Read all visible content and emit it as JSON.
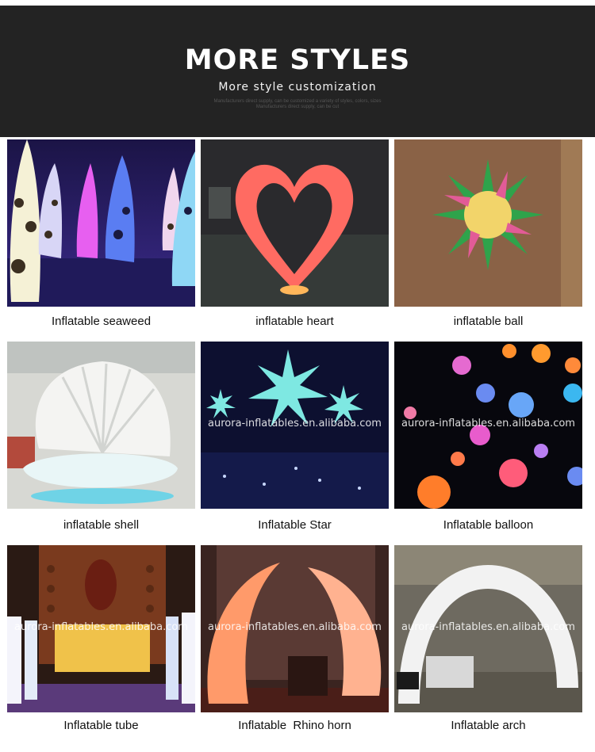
{
  "banner": {
    "title": "MORE STYLES",
    "subtitle": "More style customization",
    "fine_line_1": "Manufacturers direct supply, can be customized a variety of styles, colors, sizes",
    "fine_line_2": "Manufacturers direct supply, can be cut"
  },
  "products": [
    {
      "caption": "Inflatable seaweed",
      "watermark": ""
    },
    {
      "caption": "inflatable heart",
      "watermark": ""
    },
    {
      "caption": "inflatable ball",
      "watermark": ""
    },
    {
      "caption": "inflatable shell",
      "watermark": ""
    },
    {
      "caption": "Inflatable Star",
      "watermark": "aurora-inflatables.en.alibaba.com"
    },
    {
      "caption": "Inflatable balloon",
      "watermark": "aurora-inflatables.en.alibaba.com"
    },
    {
      "caption": "Inflatable tube",
      "watermark": "aurora-inflatables.en.alibaba.com"
    },
    {
      "caption": "Inflatable  Rhino horn",
      "watermark": "aurora-inflatables.en.alibaba.com"
    },
    {
      "caption": "Inflatable arch",
      "watermark": "aurora-inflatables.en.alibaba.com"
    }
  ],
  "colors": {
    "banner_bg": "#232323",
    "caption_text": "#111111"
  }
}
